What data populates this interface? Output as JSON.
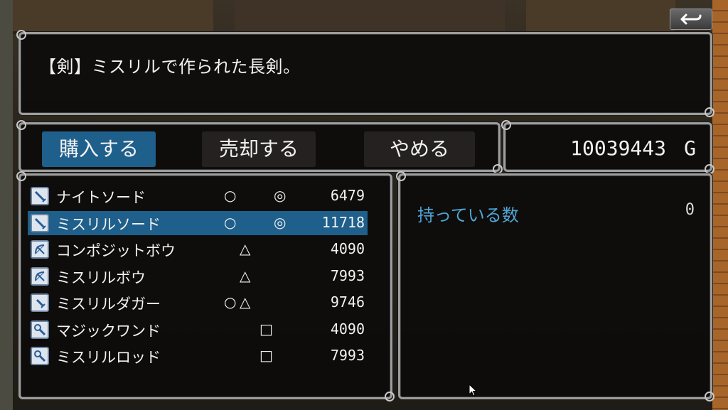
{
  "help": {
    "text": "【剣】ミスリルで作られた長剣。"
  },
  "commands": {
    "buy": "購入する",
    "sell": "売却する",
    "cancel": "やめる",
    "selected": "buy"
  },
  "gold": {
    "amount": "10039443",
    "unit": "G"
  },
  "items": [
    {
      "icon": "sword-icon",
      "name": "ナイトソード",
      "marks": [
        "○",
        "◎"
      ],
      "price": "6479",
      "selected": false
    },
    {
      "icon": "sword-icon",
      "name": "ミスリルソード",
      "marks": [
        "○",
        "◎"
      ],
      "price": "11718",
      "selected": true
    },
    {
      "icon": "bow-icon",
      "name": "コンポジットボウ",
      "marks": [
        "△"
      ],
      "price": "4090",
      "selected": false
    },
    {
      "icon": "bow-icon",
      "name": "ミスリルボウ",
      "marks": [
        "△"
      ],
      "price": "7993",
      "selected": false
    },
    {
      "icon": "dagger-icon",
      "name": "ミスリルダガー",
      "marks": [
        "○",
        "△"
      ],
      "price": "9746",
      "selected": false
    },
    {
      "icon": "staff-icon",
      "name": "マジックワンド",
      "marks": [
        "□"
      ],
      "price": "4090",
      "selected": false
    },
    {
      "icon": "staff-icon",
      "name": "ミスリルロッド",
      "marks": [
        "□"
      ],
      "price": "7993",
      "selected": false
    }
  ],
  "status": {
    "owned_label": "持っている数",
    "owned_count": "0"
  },
  "colors": {
    "selection": "#1f5f8b",
    "owned_label": "#4fa5d6"
  }
}
